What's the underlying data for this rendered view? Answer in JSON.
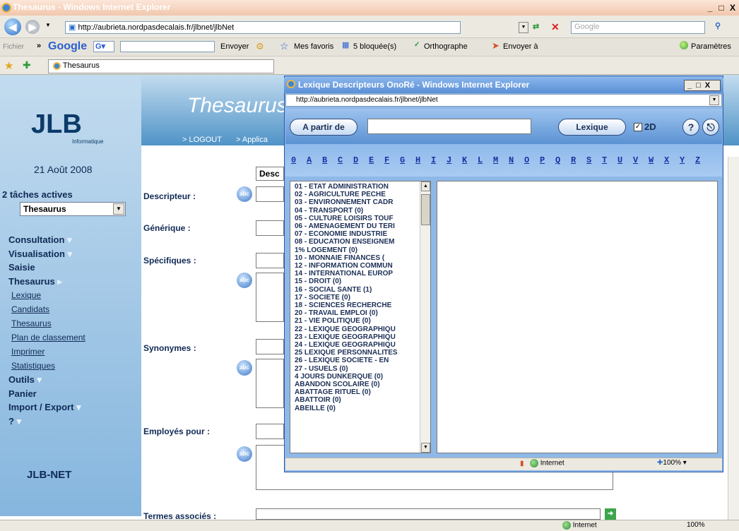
{
  "window": {
    "title": "Thesaurus - Windows Internet Explorer",
    "min": "_",
    "max": "□",
    "close": "X"
  },
  "address": {
    "url": "http://aubrieta.nordpasdecalais.fr/jlbnet/jlbNet",
    "search_placeholder": "Google"
  },
  "toolbar": {
    "fichier": "Fichier",
    "chevrons": "»",
    "google": "Google",
    "envoyer": "Envoyer",
    "favoris": "Mes favoris",
    "bloquees": "5 bloquée(s)",
    "orthographe": "Orthographe",
    "envoyer_a": "Envoyer à",
    "parametres": "Paramètres"
  },
  "tab": {
    "label": "Thesaurus"
  },
  "sidebar": {
    "logo": "JLB",
    "logo_sub": "Informatique",
    "date": "21 Août 2008",
    "tasks": "2 tâches actives",
    "task_select": "Thesaurus",
    "menu": [
      {
        "label": "Consultation",
        "type": "main"
      },
      {
        "label": "Visualisation",
        "type": "main"
      },
      {
        "label": "Saisie",
        "type": "main"
      },
      {
        "label": "Thesaurus",
        "type": "main"
      },
      {
        "label": "Lexique",
        "type": "sub"
      },
      {
        "label": "Candidats",
        "type": "sub"
      },
      {
        "label": "Thesaurus",
        "type": "sub"
      },
      {
        "label": "Plan de classement",
        "type": "sub"
      },
      {
        "label": "Imprimer",
        "type": "sub"
      },
      {
        "label": "Statistiques",
        "type": "sub"
      },
      {
        "label": "Outils",
        "type": "main"
      },
      {
        "label": "Panier",
        "type": "main"
      },
      {
        "label": "Import / Export",
        "type": "main"
      },
      {
        "label": "?",
        "type": "main"
      }
    ],
    "footer": "JLB-NET"
  },
  "main": {
    "title": "Thesaurus",
    "logout": "> LOGOUT",
    "applica": "> Applica",
    "desc_tab": "Desc",
    "labels": {
      "descripteur": "Descripteur :",
      "generique": "Générique :",
      "specifiques": "Spécifiques :",
      "synonymes": "Synonymes :",
      "employes": "Employés pour :",
      "termes": "Termes associés :"
    },
    "abc": "abc"
  },
  "popup": {
    "title": "Lexique Descripteurs OnoRé - Windows Internet Explorer",
    "url": "http://aubrieta.nordpasdecalais.fr/jlbnet/jlbNet",
    "a_partir_de": "A partir de",
    "lexique": "Lexique",
    "twod": "2D",
    "help": "?",
    "letters": [
      "0",
      "A",
      "B",
      "C",
      "D",
      "E",
      "F",
      "G",
      "H",
      "I",
      "J",
      "K",
      "L",
      "M",
      "N",
      "O",
      "P",
      "Q",
      "R",
      "S",
      "T",
      "U",
      "V",
      "W",
      "X",
      "Y",
      "Z"
    ],
    "items": [
      "01 - ETAT ADMINISTRATION",
      "02 - AGRICULTURE PECHE",
      "03 - ENVIRONNEMENT CADR",
      "04 - TRANSPORT   (0)",
      "05 - CULTURE LOISIRS TOUF",
      "06 - AMENAGEMENT DU TERI",
      "07 - ECONOMIE INDUSTRIE",
      "08 - EDUCATION ENSEIGNEM",
      "1% LOGEMENT   (0)",
      "10 - MONNAIE FINANCES   (",
      "12 - INFORMATION COMMUN",
      "14 - INTERNATIONAL EUROP",
      "15 - DROIT   (0)",
      "16 - SOCIAL SANTE   (1)",
      "17 - SOCIETE   (0)",
      "18 - SCIENCES RECHERCHE",
      "20 - TRAVAIL EMPLOI   (0)",
      "21 - VIE POLITIQUE   (0)",
      "22 - LEXIQUE GEOGRAPHIQU",
      "23 - LEXIQUE GEOGRAPHIQU",
      "24 - LEXIQUE GEOGRAPHIQU",
      "25 LEXIQUE PERSONNALITES",
      "26 - LEXIQUE SOCIETE  - EN",
      "27 - USUELS   (0)",
      "4 JOURS DUNKERQUE   (0)",
      "ABANDON SCOLAIRE   (0)",
      "ABATTAGE RITUEL   (0)",
      "ABATTOIR   (0)",
      "ABEILLE   (0)"
    ],
    "status_zone": "Internet",
    "zoom": "100%"
  },
  "statusbar": {
    "zone": "Internet",
    "zoom": "100%"
  }
}
